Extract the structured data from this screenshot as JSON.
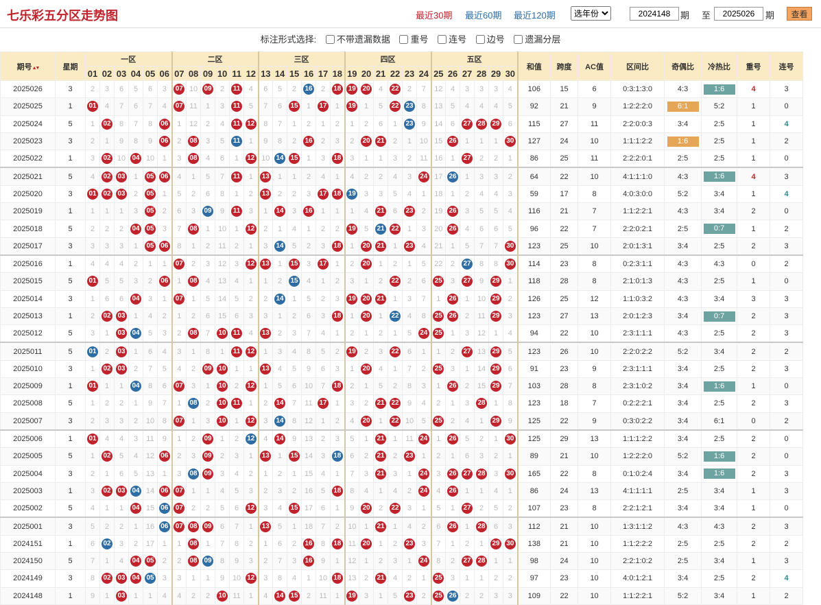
{
  "header": {
    "title": "七乐彩五分区走势图",
    "nav": [
      {
        "label": "最近30期",
        "active": true
      },
      {
        "label": "最近60期",
        "active": false
      },
      {
        "label": "最近120期",
        "active": false
      }
    ],
    "year_select": "选年份",
    "from_label": "期",
    "from_value": "2024148",
    "to_label": "至",
    "to_value": "2025026",
    "to_suffix": "期",
    "query_label": "查看"
  },
  "options": {
    "label": "标注形式选择:",
    "items": [
      "不带遗漏数据",
      "重号",
      "连号",
      "边号",
      "遗漏分层"
    ]
  },
  "columns": {
    "issue": "期号",
    "weekday": "星期",
    "zones": [
      "一区",
      "二区",
      "三区",
      "四区",
      "五区"
    ],
    "sum": "和值",
    "span": "跨度",
    "ac": "AC值",
    "ratio": "区间比",
    "odd_even": "奇偶比",
    "hot_cold": "冷热比",
    "repeat": "重号",
    "consec": "连号"
  },
  "rows": [
    {
      "issue": "2025026",
      "wd": "3",
      "nums": [
        7,
        9,
        11,
        16,
        18,
        19,
        20,
        22
      ],
      "blue": [
        16
      ],
      "ring": [
        9,
        11,
        18,
        19,
        20
      ],
      "sum": "106",
      "span": "15",
      "ac": "6",
      "ratio": "0:3:1:3:0",
      "oe": "4:3",
      "hc": "1:6",
      "hcHl": "teal",
      "rep": "4",
      "repHl": true,
      "con": "3",
      "conHl": false
    },
    {
      "issue": "2025025",
      "wd": "1",
      "nums": [
        1,
        7,
        11,
        15,
        17,
        19,
        22,
        23
      ],
      "blue": [
        23
      ],
      "ring": [
        11,
        22
      ],
      "sum": "92",
      "span": "21",
      "ac": "9",
      "ratio": "1:2:2:2:0",
      "oe": "6:1",
      "oeHl": "orange",
      "hc": "5:2",
      "rep": "1",
      "con": "0"
    },
    {
      "issue": "2025024",
      "wd": "5",
      "nums": [
        2,
        6,
        11,
        12,
        23,
        27,
        28,
        29
      ],
      "blue": [
        23
      ],
      "ring": [
        2,
        11,
        12,
        27,
        28,
        29
      ],
      "sum": "115",
      "span": "27",
      "ac": "11",
      "ratio": "2:2:0:0:3",
      "oe": "3:4",
      "hc": "2:5",
      "rep": "1",
      "con": "4",
      "conHl": true
    },
    {
      "issue": "2025023",
      "wd": "3",
      "nums": [
        6,
        8,
        11,
        16,
        20,
        21,
        26,
        30
      ],
      "blue": [
        11
      ],
      "ring": [
        8,
        16,
        20,
        21,
        26,
        30
      ],
      "sum": "127",
      "span": "24",
      "ac": "10",
      "ratio": "1:1:1:2:2",
      "oe": "1:6",
      "oeHl": "orange",
      "hc": "2:5",
      "rep": "1",
      "con": "2"
    },
    {
      "issue": "2025022",
      "wd": "1",
      "nums": [
        2,
        4,
        8,
        12,
        14,
        15,
        18,
        27
      ],
      "blue": [
        14
      ],
      "ring": [
        2,
        8,
        12,
        14,
        15,
        18,
        27
      ],
      "sum": "86",
      "span": "25",
      "ac": "11",
      "ratio": "2:2:2:0:1",
      "oe": "2:5",
      "hc": "2:5",
      "rep": "1",
      "con": "0"
    },
    {
      "issue": "2025021",
      "wd": "5",
      "nums": [
        2,
        3,
        5,
        6,
        11,
        13,
        24,
        26
      ],
      "blue": [
        26
      ],
      "ring": [
        2,
        3,
        5,
        6,
        11,
        13,
        24
      ],
      "sum": "64",
      "span": "22",
      "ac": "10",
      "ratio": "4:1:1:1:0",
      "oe": "4:3",
      "hc": "1:6",
      "hcHl": "teal",
      "rep": "4",
      "repHl": true,
      "con": "3",
      "sep": true
    },
    {
      "issue": "2025020",
      "wd": "3",
      "nums": [
        1,
        2,
        3,
        5,
        13,
        17,
        18,
        19
      ],
      "blue": [
        19
      ],
      "ring": [
        1,
        2,
        3,
        5,
        13,
        17,
        18
      ],
      "sum": "59",
      "span": "17",
      "ac": "8",
      "ratio": "4:0:3:0:0",
      "oe": "5:2",
      "hc": "3:4",
      "rep": "1",
      "con": "4",
      "conHl": true
    },
    {
      "issue": "2025019",
      "wd": "1",
      "nums": [
        5,
        9,
        11,
        14,
        16,
        21,
        23,
        26
      ],
      "blue": [
        9
      ],
      "ring": [
        5,
        11,
        14,
        16,
        21,
        23,
        26
      ],
      "sum": "116",
      "span": "21",
      "ac": "7",
      "ratio": "1:1:2:2:1",
      "oe": "4:3",
      "hc": "3:4",
      "rep": "2",
      "con": "0"
    },
    {
      "issue": "2025018",
      "wd": "5",
      "nums": [
        4,
        5,
        8,
        12,
        19,
        21,
        22,
        26
      ],
      "blue": [
        21
      ],
      "ring": [
        4,
        5,
        8,
        12,
        19,
        21,
        22,
        26
      ],
      "sum": "96",
      "span": "22",
      "ac": "7",
      "ratio": "2:2:0:2:1",
      "oe": "2:5",
      "hc": "0:7",
      "hcHl": "teal",
      "rep": "1",
      "con": "2"
    },
    {
      "issue": "2025017",
      "wd": "3",
      "nums": [
        5,
        6,
        14,
        18,
        20,
        21,
        23,
        30
      ],
      "blue": [
        14
      ],
      "ring": [
        5,
        6,
        18,
        20,
        21,
        23,
        30
      ],
      "sum": "123",
      "span": "25",
      "ac": "10",
      "ratio": "2:0:1:3:1",
      "oe": "3:4",
      "hc": "2:5",
      "rep": "2",
      "con": "3"
    },
    {
      "issue": "2025016",
      "wd": "1",
      "nums": [
        7,
        12,
        13,
        15,
        17,
        20,
        27,
        30
      ],
      "blue": [
        27
      ],
      "ring": [
        7,
        12,
        13,
        15,
        17,
        20,
        30
      ],
      "sum": "114",
      "span": "23",
      "ac": "8",
      "ratio": "0:2:3:1:1",
      "oe": "4:3",
      "hc": "4:3",
      "rep": "0",
      "con": "2",
      "sep": true
    },
    {
      "issue": "2025015",
      "wd": "5",
      "nums": [
        1,
        6,
        8,
        15,
        22,
        25,
        27,
        29
      ],
      "blue": [
        15
      ],
      "ring": [
        1,
        6,
        8,
        22,
        25,
        27,
        29
      ],
      "sum": "118",
      "span": "28",
      "ac": "8",
      "ratio": "2:1:0:1:3",
      "oe": "4:3",
      "hc": "2:5",
      "rep": "1",
      "con": "0"
    },
    {
      "issue": "2025014",
      "wd": "3",
      "nums": [
        4,
        7,
        14,
        19,
        20,
        21,
        26,
        29
      ],
      "blue": [
        14
      ],
      "ring": [
        4,
        7,
        19,
        20,
        21,
        26,
        29
      ],
      "sum": "126",
      "span": "25",
      "ac": "12",
      "ratio": "1:1:0:3:2",
      "oe": "4:3",
      "hc": "3:4",
      "rep": "3",
      "con": "3"
    },
    {
      "issue": "2025013",
      "wd": "1",
      "nums": [
        2,
        3,
        18,
        20,
        22,
        25,
        26,
        29
      ],
      "blue": [
        22
      ],
      "ring": [
        2,
        3,
        18,
        20,
        25,
        26,
        29
      ],
      "sum": "123",
      "span": "27",
      "ac": "13",
      "ratio": "2:0:1:2:3",
      "oe": "3:4",
      "hc": "0:7",
      "hcHl": "teal",
      "rep": "2",
      "con": "3"
    },
    {
      "issue": "2025012",
      "wd": "5",
      "nums": [
        3,
        4,
        8,
        10,
        11,
        13,
        24,
        25
      ],
      "blue": [
        4
      ],
      "ring": [
        3,
        8,
        10,
        11,
        13,
        24,
        25
      ],
      "sum": "94",
      "span": "22",
      "ac": "10",
      "ratio": "2:3:1:1:1",
      "oe": "4:3",
      "hc": "2:5",
      "rep": "2",
      "con": "3"
    },
    {
      "issue": "2025011",
      "wd": "5",
      "nums": [
        1,
        3,
        11,
        12,
        19,
        22,
        27,
        29
      ],
      "blue": [
        1
      ],
      "ring": [
        3,
        11,
        12,
        19,
        22,
        27,
        29
      ],
      "sum": "123",
      "span": "26",
      "ac": "10",
      "ratio": "2:2:0:2:2",
      "oe": "5:2",
      "hc": "3:4",
      "rep": "2",
      "con": "2",
      "sep": true
    },
    {
      "issue": "2025010",
      "wd": "3",
      "nums": [
        2,
        3,
        9,
        10,
        13,
        20,
        25,
        29
      ],
      "blue": [],
      "ring": [
        2,
        3,
        9,
        10,
        13,
        20,
        25,
        29
      ],
      "sum": "91",
      "span": "23",
      "ac": "9",
      "ratio": "2:3:1:1:1",
      "oe": "3:4",
      "hc": "2:5",
      "rep": "2",
      "con": "3"
    },
    {
      "issue": "2025009",
      "wd": "1",
      "nums": [
        1,
        4,
        7,
        10,
        12,
        18,
        26,
        29
      ],
      "blue": [
        4
      ],
      "ring": [
        1,
        7,
        10,
        12,
        18,
        26,
        29
      ],
      "sum": "103",
      "span": "28",
      "ac": "8",
      "ratio": "2:3:1:0:2",
      "oe": "3:4",
      "hc": "1:6",
      "hcHl": "teal",
      "rep": "1",
      "con": "0"
    },
    {
      "issue": "2025008",
      "wd": "5",
      "nums": [
        8,
        10,
        11,
        14,
        17,
        21,
        22,
        28
      ],
      "blue": [
        8
      ],
      "ring": [
        10,
        11,
        14,
        17,
        21,
        22,
        28
      ],
      "sum": "123",
      "span": "18",
      "ac": "7",
      "ratio": "0:2:2:2:1",
      "oe": "3:4",
      "hc": "2:5",
      "rep": "2",
      "con": "3"
    },
    {
      "issue": "2025007",
      "wd": "3",
      "nums": [
        7,
        10,
        12,
        14,
        20,
        22,
        25,
        29
      ],
      "blue": [
        14
      ],
      "ring": [
        7,
        10,
        12,
        20,
        22,
        25,
        29
      ],
      "sum": "125",
      "span": "22",
      "ac": "9",
      "ratio": "0:3:0:2:2",
      "oe": "3:4",
      "hc": "6:1",
      "rep": "0",
      "con": "2"
    },
    {
      "issue": "2025006",
      "wd": "1",
      "nums": [
        1,
        9,
        12,
        14,
        21,
        24,
        26,
        30
      ],
      "blue": [
        12
      ],
      "ring": [
        1,
        9,
        14,
        21,
        24,
        26,
        30
      ],
      "sum": "125",
      "span": "29",
      "ac": "13",
      "ratio": "1:1:1:2:2",
      "oe": "3:4",
      "hc": "2:5",
      "rep": "2",
      "con": "0",
      "sep": true
    },
    {
      "issue": "2025005",
      "wd": "5",
      "nums": [
        2,
        6,
        9,
        13,
        15,
        18,
        21,
        23
      ],
      "blue": [
        18
      ],
      "ring": [
        2,
        6,
        9,
        13,
        15,
        21,
        23
      ],
      "sum": "89",
      "span": "21",
      "ac": "10",
      "ratio": "1:2:2:2:0",
      "oe": "5:2",
      "hc": "1:6",
      "hcHl": "teal",
      "rep": "2",
      "con": "0"
    },
    {
      "issue": "2025004",
      "wd": "3",
      "nums": [
        8,
        9,
        21,
        24,
        26,
        27,
        28,
        30
      ],
      "blue": [
        8
      ],
      "ring": [
        9,
        21,
        24,
        26,
        27,
        28,
        30
      ],
      "sum": "165",
      "span": "22",
      "ac": "8",
      "ratio": "0:1:0:2:4",
      "oe": "3:4",
      "hc": "1:6",
      "hcHl": "teal",
      "rep": "2",
      "con": "3"
    },
    {
      "issue": "2025003",
      "wd": "1",
      "nums": [
        2,
        3,
        4,
        6,
        7,
        18,
        24,
        26
      ],
      "blue": [
        4
      ],
      "ring": [
        2,
        3,
        6,
        7,
        18,
        24,
        26
      ],
      "sum": "86",
      "span": "24",
      "ac": "13",
      "ratio": "4:1:1:1:1",
      "oe": "2:5",
      "hc": "3:4",
      "rep": "1",
      "con": "3"
    },
    {
      "issue": "2025002",
      "wd": "5",
      "nums": [
        4,
        6,
        7,
        12,
        15,
        20,
        22,
        27
      ],
      "blue": [
        6
      ],
      "ring": [
        4,
        7,
        12,
        15,
        20,
        22,
        27
      ],
      "sum": "107",
      "span": "23",
      "ac": "8",
      "ratio": "2:2:1:2:1",
      "oe": "3:4",
      "hc": "3:4",
      "rep": "1",
      "con": "0"
    },
    {
      "issue": "2025001",
      "wd": "3",
      "nums": [
        6,
        7,
        8,
        9,
        13,
        21,
        26,
        28
      ],
      "blue": [
        6
      ],
      "ring": [
        7,
        8,
        9,
        13,
        21,
        26,
        28
      ],
      "sum": "112",
      "span": "21",
      "ac": "10",
      "ratio": "1:3:1:1:2",
      "oe": "4:3",
      "hc": "4:3",
      "rep": "2",
      "con": "3",
      "sep": true
    },
    {
      "issue": "2024151",
      "wd": "1",
      "nums": [
        2,
        8,
        16,
        18,
        20,
        23,
        29,
        30
      ],
      "blue": [
        2
      ],
      "ring": [
        8,
        16,
        18,
        20,
        23,
        29,
        30
      ],
      "sum": "138",
      "span": "21",
      "ac": "10",
      "ratio": "1:1:2:2:2",
      "oe": "2:5",
      "hc": "2:5",
      "rep": "2",
      "con": "2"
    },
    {
      "issue": "2024150",
      "wd": "5",
      "nums": [
        4,
        5,
        8,
        9,
        16,
        24,
        27,
        28
      ],
      "blue": [
        9
      ],
      "ring": [
        4,
        5,
        8,
        16,
        24,
        27,
        28
      ],
      "sum": "98",
      "span": "24",
      "ac": "10",
      "ratio": "2:2:1:0:2",
      "oe": "2:5",
      "hc": "3:4",
      "rep": "1",
      "con": "3"
    },
    {
      "issue": "2024149",
      "wd": "3",
      "nums": [
        2,
        3,
        4,
        5,
        12,
        18,
        21,
        25
      ],
      "blue": [
        5
      ],
      "ring": [
        2,
        3,
        4,
        12,
        18,
        21,
        25
      ],
      "sum": "97",
      "span": "23",
      "ac": "10",
      "ratio": "4:0:1:2:1",
      "oe": "3:4",
      "hc": "2:5",
      "rep": "2",
      "con": "4",
      "conHl": true
    },
    {
      "issue": "2024148",
      "wd": "1",
      "nums": [
        3,
        10,
        14,
        15,
        19,
        23,
        25,
        26
      ],
      "blue": [
        26
      ],
      "ring": [
        3,
        10,
        14,
        15,
        19,
        23,
        25
      ],
      "sum": "109",
      "span": "22",
      "ac": "10",
      "ratio": "1:1:2:2:1",
      "oe": "5:2",
      "hc": "3:4",
      "rep": "1",
      "con": "2"
    }
  ],
  "colors": {
    "red": "#c0232c",
    "blue": "#2e6da4",
    "accent": "#fbebc5"
  }
}
